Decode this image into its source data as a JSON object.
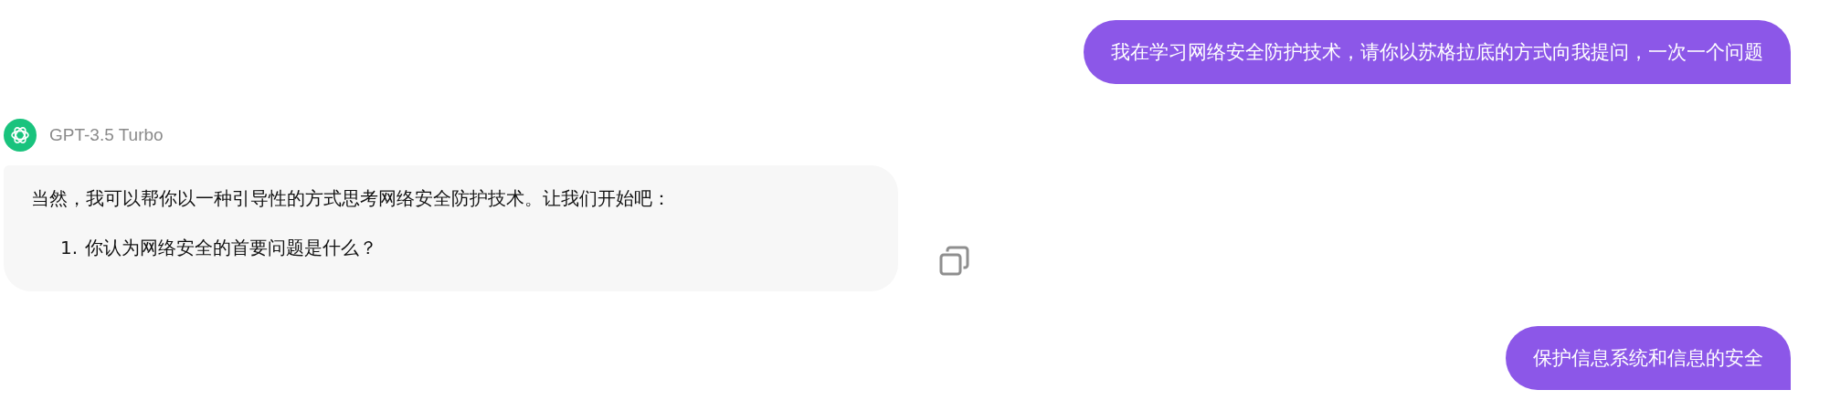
{
  "messages": [
    {
      "kind": "user",
      "text": "我在学习网络安全防护技术，请你以苏格拉底的方式向我提问，一次一个问题"
    },
    {
      "kind": "assistant",
      "model": "GPT-3.5 Turbo",
      "intro": "当然，我可以帮你以一种引导性的方式思考网络安全防护技术。让我们开始吧：",
      "items": [
        {
          "number": "1.",
          "text": "你认为网络安全的首要问题是什么？"
        }
      ]
    },
    {
      "kind": "user",
      "text": "保护信息系统和信息的安全"
    }
  ]
}
